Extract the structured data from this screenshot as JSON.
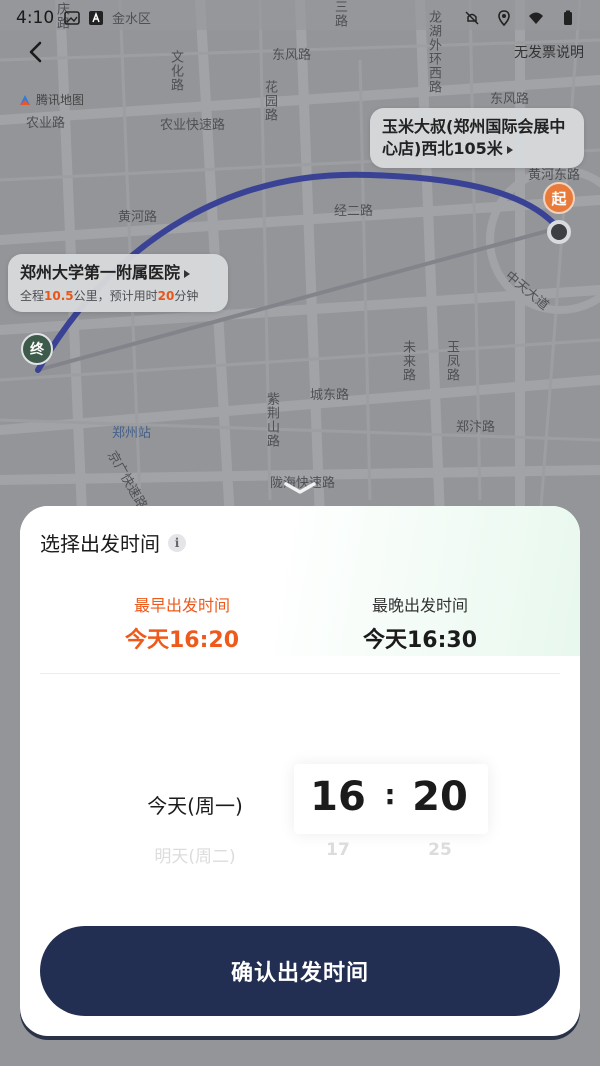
{
  "status_bar": {
    "time": "4:10"
  },
  "header": {
    "invoice_link": "无发票说明"
  },
  "map": {
    "provider": "腾讯地图",
    "labels": {
      "l1": "金水区",
      "l2": "庆路",
      "l3": "文化路",
      "l4": "东风路",
      "l5": "花园路",
      "l6": "龙湖外环西路",
      "l7": "三路",
      "l8": "东风路",
      "l9": "农业路",
      "l10": "农业快速路",
      "l11": "黄河路",
      "l12": "经二路",
      "l13": "未来路",
      "l14": "玉凤路",
      "l15": "城东路",
      "l16": "紫荆山路",
      "l17": "郑州站",
      "l18": "郑汴路",
      "l19": "陇海快速路",
      "l20": "中天大道",
      "l21": "黄河东路",
      "l22": "京广快速路"
    },
    "start_callout": "玉米大叔(郑州国际会展中心店)西北105米",
    "dest_callout": {
      "name": "郑州大学第一附属医院",
      "info_prefix": "全程",
      "distance": "10.5",
      "info_mid": "公里，预计用时",
      "duration": "20",
      "info_suffix": "分钟"
    },
    "start_marker": "起",
    "end_marker": "终",
    "route_color": "#3a45b8"
  },
  "sheet": {
    "title": "选择出发时间",
    "info_icon": "i",
    "earliest": {
      "label": "最早出发时间",
      "value": "今天16:20"
    },
    "latest": {
      "label": "最晚出发时间",
      "value": "今天16:30"
    },
    "picker": {
      "day_selected": "今天(周一)",
      "day_next": "明天(周二)",
      "hour_selected": "16",
      "hour_next": "17",
      "colon": ":",
      "minute_selected": "20",
      "minute_next": "25"
    },
    "confirm_label": "确认出发时间"
  },
  "colors": {
    "accent": "#ee5a1c",
    "button": "#232f52"
  }
}
